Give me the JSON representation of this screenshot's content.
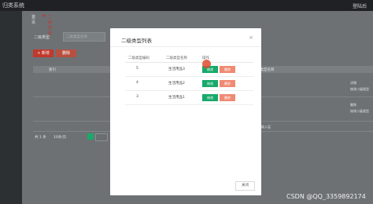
{
  "app": {
    "title": "归类系统",
    "top_right": "登陆后"
  },
  "tabs": {
    "home": "首页",
    "active": "二级类型"
  },
  "filter": {
    "label": "二级类型",
    "placeholder": "二级类型名称"
  },
  "toolbar": {
    "add_label": "+ 新增",
    "delete_label": "删除"
  },
  "grid": {
    "index_label": "索引",
    "column_label": "级类型名称"
  },
  "bg_rows": {
    "row1_actions": [
      "详情",
      "修改二级类型"
    ],
    "row2_actions": [
      "删除",
      "修改二级类型"
    ],
    "row3_tag": "级入层"
  },
  "pager": {
    "total": "共 1 条",
    "page_size": "10条/页"
  },
  "modal": {
    "title": "二级类型列表",
    "close_icon": "×",
    "columns": [
      "二级类型编码",
      "二级类型名称",
      "操作"
    ],
    "rows": [
      {
        "code": "5",
        "name": "生活用品3",
        "edit": "修改",
        "delete": "删除"
      },
      {
        "code": "4",
        "name": "生活用品2",
        "edit": "修改",
        "delete": "删除"
      },
      {
        "code": "3",
        "name": "生活用品1",
        "edit": "修改",
        "delete": "删除"
      }
    ],
    "footer_close": "关闭"
  },
  "watermark": "CSDN @QQ_3359892174",
  "colors": {
    "primary": "#18a96b",
    "danger": "#ef8a73",
    "accent": "#c0392b"
  }
}
